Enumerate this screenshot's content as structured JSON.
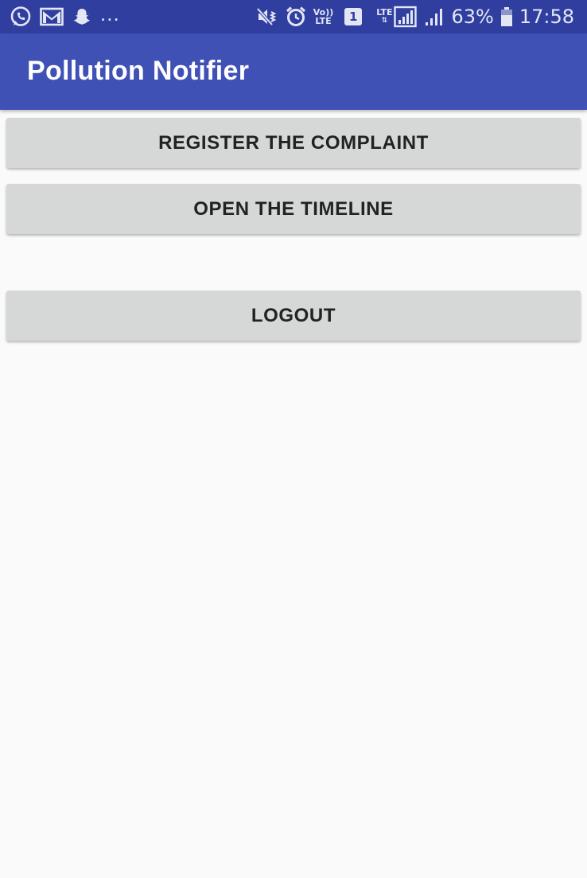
{
  "status_bar": {
    "background": "#303f9f",
    "left_icons": [
      "whatsapp-icon",
      "gmail-icon",
      "snapchat-icon"
    ],
    "more_notifications": "...",
    "right_icons": [
      "mute-vibrate-icon",
      "alarm-icon",
      "volte-icon",
      "sim-1-icon",
      "lte-signal-icon",
      "signal-icon",
      "battery-icon"
    ],
    "volte_label_top": "Vo))",
    "volte_label_bottom": "LTE",
    "sim_label": "1",
    "lte_label": "LTE",
    "battery_percent": "63%",
    "time": "17:58"
  },
  "app_bar": {
    "title": "Pollution Notifier",
    "color": "#3f51b5"
  },
  "buttons": {
    "register": "REGISTER THE COMPLAINT",
    "timeline": "OPEN THE TIMELINE",
    "logout": "LOGOUT"
  },
  "colors": {
    "background": "#fafafa",
    "button": "#d6d7d7",
    "button_text": "#222222"
  }
}
